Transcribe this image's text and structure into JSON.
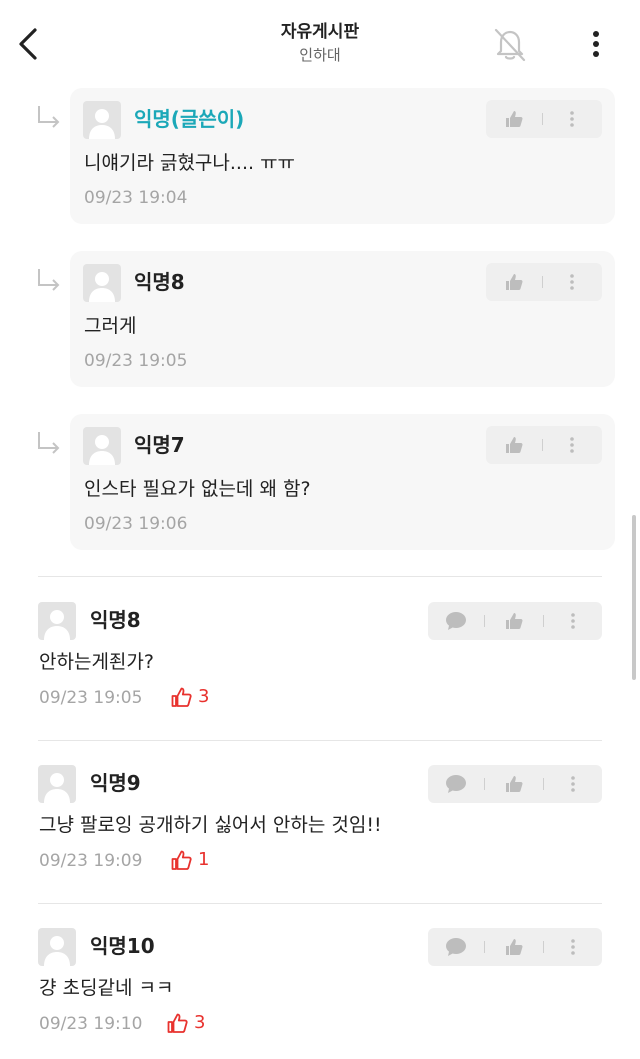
{
  "header": {
    "title": "자유게시판",
    "subtitle": "인하대",
    "back_icon": "chevron-left-icon",
    "bell_icon": "bell-off-icon",
    "more_icon": "more-vertical-icon"
  },
  "replies": [
    {
      "author": "익명(글쓴이)",
      "is_op": true,
      "text": "니얘기라 긁혔구나.... ㅠㅠ",
      "time": "09/23 19:04"
    },
    {
      "author": "익명8",
      "is_op": false,
      "text": "그러게",
      "time": "09/23 19:05"
    },
    {
      "author": "익명7",
      "is_op": false,
      "text": "인스타 필요가 없는데 왜 함?",
      "time": "09/23 19:06"
    }
  ],
  "comments": [
    {
      "author": "익명8",
      "text": "안하는게죈가?",
      "time": "09/23 19:05",
      "likes": "3"
    },
    {
      "author": "익명9",
      "text": "그냥 팔로잉 공개하기 싫어서 안하는 것임!!",
      "time": "09/23 19:09",
      "likes": "1"
    },
    {
      "author": "익명10",
      "text": "걍 초딩같네 ㅋㅋ",
      "time": "09/23 19:10",
      "likes": "3"
    }
  ],
  "colors": {
    "op_author": "#1ba8b8",
    "like_count": "#e8322e",
    "timestamp": "#a5a5a5",
    "reply_bg": "#f7f7f7"
  }
}
